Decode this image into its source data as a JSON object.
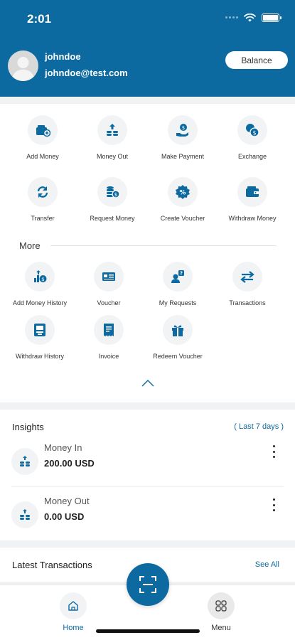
{
  "status_bar": {
    "time": "2:01"
  },
  "profile": {
    "username": "johndoe",
    "email": "johndoe@test.com",
    "balance_button": "Balance"
  },
  "actions": [
    {
      "label": "Add Money",
      "icon": "wallet-plus-icon"
    },
    {
      "label": "Money Out",
      "icon": "upload-coins-icon"
    },
    {
      "label": "Make Payment",
      "icon": "hand-payment-icon"
    },
    {
      "label": "Exchange",
      "icon": "currency-exchange-icon"
    },
    {
      "label": "Transfer",
      "icon": "transfer-arrows-icon"
    },
    {
      "label": "Request Money",
      "icon": "coins-request-icon"
    },
    {
      "label": "Create Voucher",
      "icon": "discount-badge-icon"
    },
    {
      "label": "Withdraw Money",
      "icon": "wallet-icon"
    }
  ],
  "more": {
    "label": "More",
    "items": [
      {
        "label": "Add Money History",
        "icon": "chart-coin-icon"
      },
      {
        "label": "Voucher",
        "icon": "voucher-card-icon"
      },
      {
        "label": "My Requests",
        "icon": "user-question-icon"
      },
      {
        "label": "Transactions",
        "icon": "swap-arrows-icon"
      },
      {
        "label": "Withdraw History",
        "icon": "atm-icon"
      },
      {
        "label": "Invoice",
        "icon": "invoice-icon"
      },
      {
        "label": "Redeem Voucher",
        "icon": "gift-icon"
      }
    ]
  },
  "insights": {
    "title": "Insights",
    "range": "( Last 7 days )",
    "items": [
      {
        "name": "Money In",
        "amount": "200.00 USD"
      },
      {
        "name": "Money Out",
        "amount": "0.00 USD"
      }
    ]
  },
  "latest": {
    "title": "Latest Transactions",
    "see_all": "See All"
  },
  "nav": {
    "home": "Home",
    "menu": "Menu"
  },
  "colors": {
    "brand": "#0c6aa0",
    "icon_bg": "#f1f3f5"
  }
}
